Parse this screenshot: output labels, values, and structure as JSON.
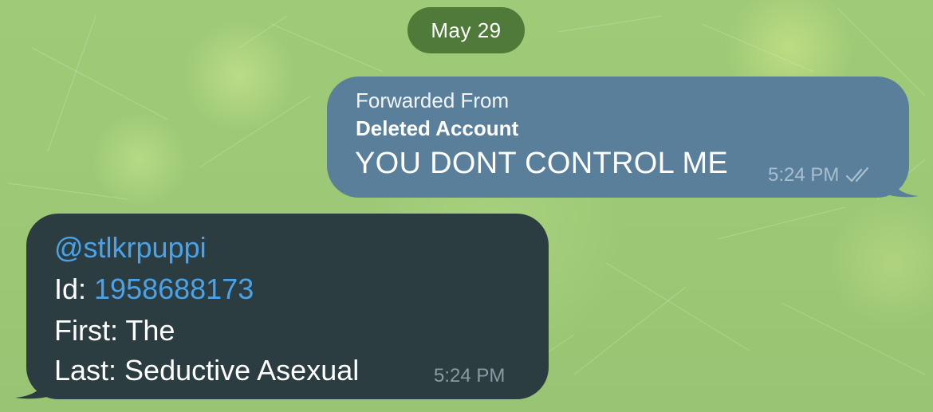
{
  "date_separator": "May 29",
  "outgoing_message": {
    "forwarded_label": "Forwarded From",
    "forwarded_from": "Deleted Account",
    "text": "YOU DONT CONTROL ME",
    "time": "5:24 PM",
    "status_icon": "double-check-icon"
  },
  "incoming_message": {
    "username": "@stlkrpuppi",
    "id_label": "Id: ",
    "id_value": "1958688173",
    "first_line": "First: The",
    "last_line": "Last: Seductive Asexual",
    "time": "5:24 PM"
  },
  "colors": {
    "background": "#9dc976",
    "date_pill": "#4f7a39",
    "outgoing_bubble": "#5a7f9b",
    "incoming_bubble": "#2c3d42",
    "link": "#4aa3e8"
  }
}
